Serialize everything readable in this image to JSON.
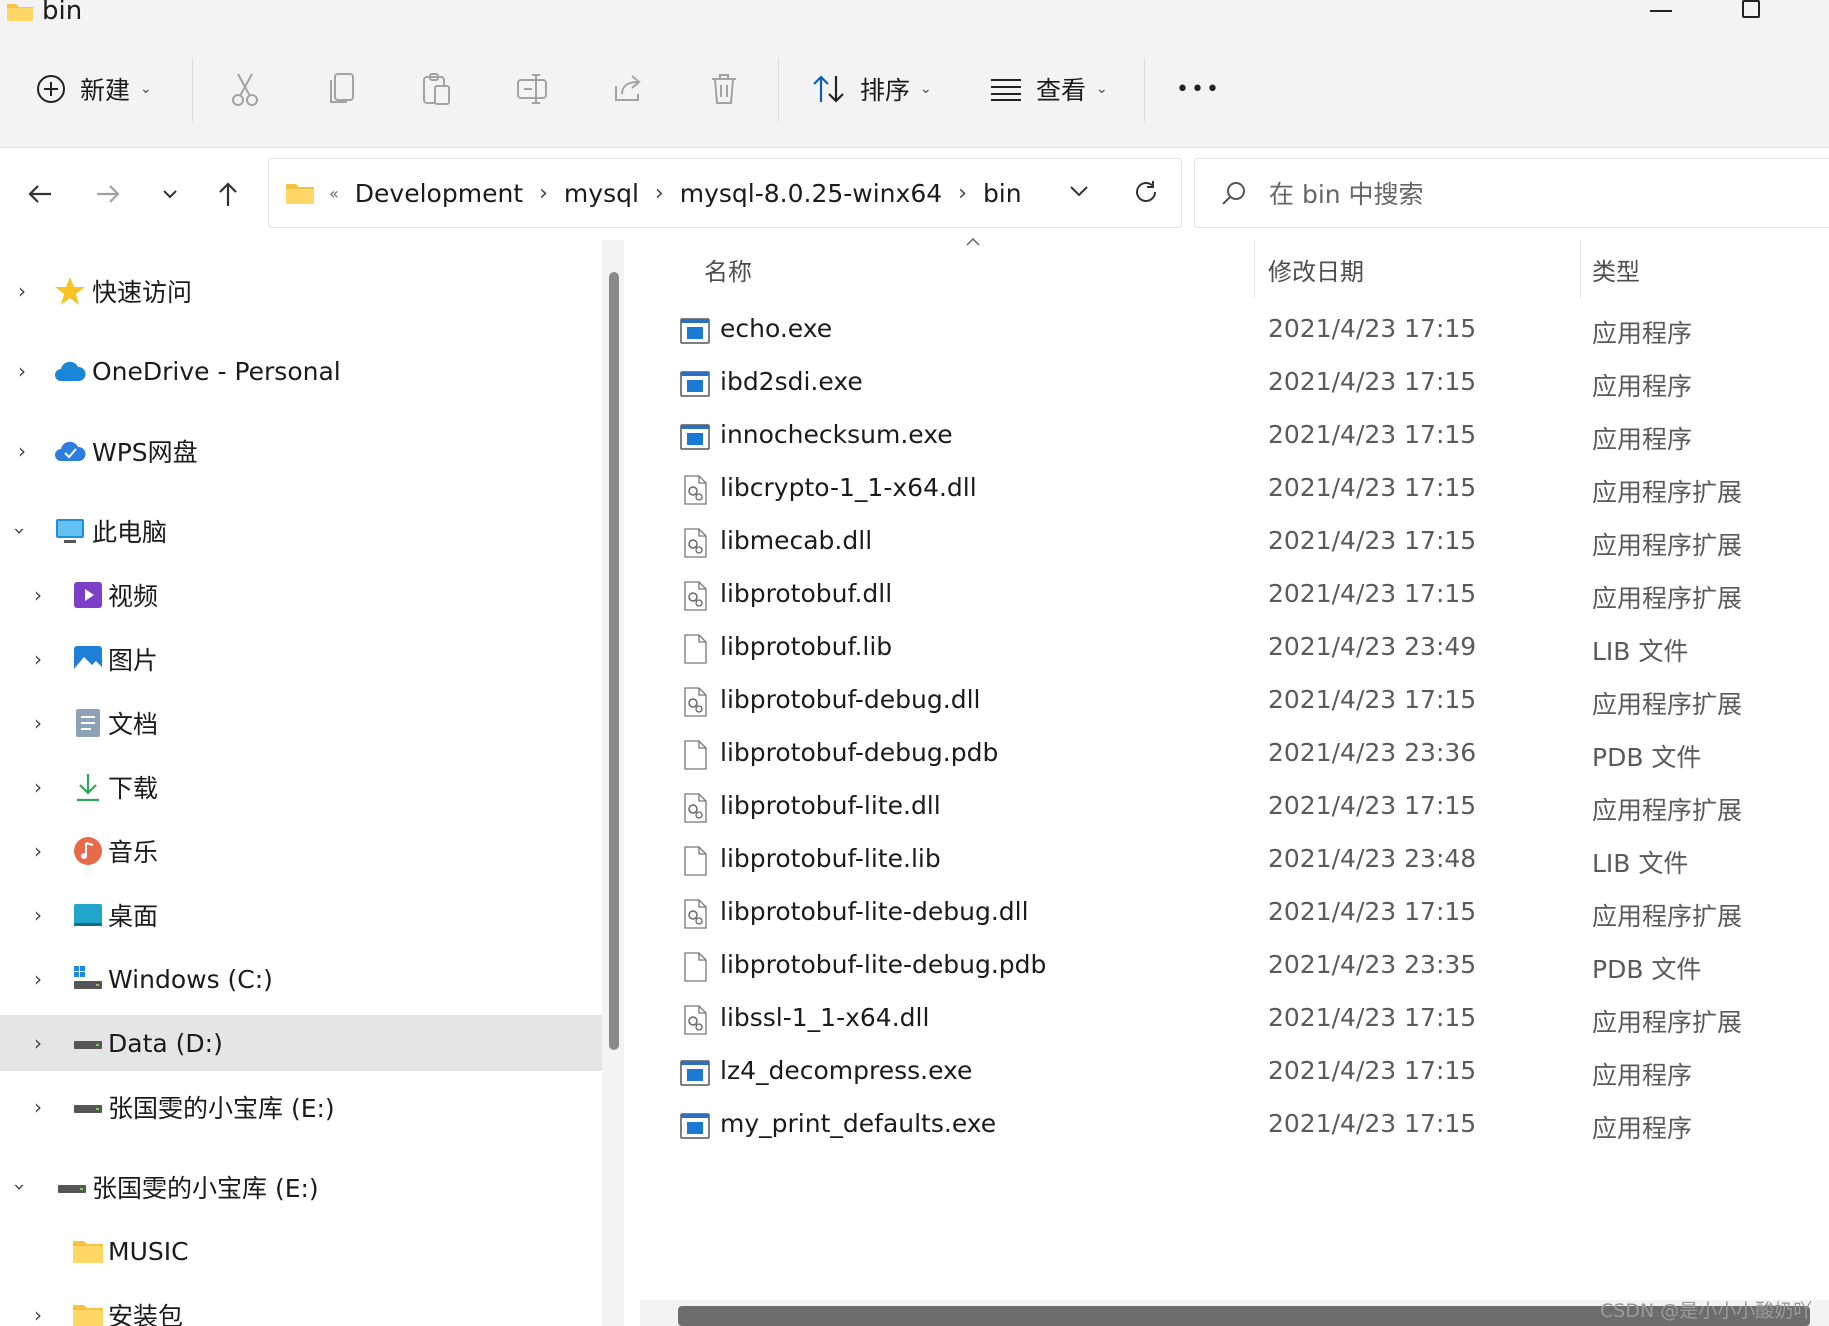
{
  "window": {
    "title": "bin"
  },
  "toolbar": {
    "new_label": "新建",
    "sort_label": "排序",
    "view_label": "查看",
    "more_label": "•••"
  },
  "address": {
    "overflow": "«",
    "crumbs": [
      "Development",
      "mysql",
      "mysql-8.0.25-winx64",
      "bin"
    ],
    "search_placeholder": "在 bin 中搜索"
  },
  "sidebar": {
    "items": [
      {
        "label": "快速访问",
        "icon": "star-icon"
      },
      {
        "label": "OneDrive - Personal",
        "icon": "cloud-icon"
      },
      {
        "label": "WPS网盘",
        "icon": "cloud-icon"
      },
      {
        "label": "此电脑",
        "icon": "monitor-icon"
      },
      {
        "label": "视频",
        "icon": "video-icon"
      },
      {
        "label": "图片",
        "icon": "picture-icon"
      },
      {
        "label": "文档",
        "icon": "document-icon"
      },
      {
        "label": "下载",
        "icon": "download-icon"
      },
      {
        "label": "音乐",
        "icon": "music-icon"
      },
      {
        "label": "桌面",
        "icon": "desktop-icon"
      },
      {
        "label": "Windows (C:)",
        "icon": "drive-icon"
      },
      {
        "label": "Data (D:)",
        "icon": "drive-icon",
        "selected": true
      },
      {
        "label": "张国雯的小宝库 (E:)",
        "icon": "drive-icon"
      },
      {
        "label": "张国雯的小宝库 (E:)",
        "icon": "drive-icon"
      },
      {
        "label": "MUSIC",
        "icon": "folder-icon"
      },
      {
        "label": "安装包",
        "icon": "folder-icon"
      }
    ]
  },
  "columns": {
    "name": "名称",
    "date": "修改日期",
    "type": "类型"
  },
  "files": [
    {
      "name": "echo.exe",
      "date": "2021/4/23 17:15",
      "type": "应用程序",
      "kind": "exe"
    },
    {
      "name": "ibd2sdi.exe",
      "date": "2021/4/23 17:15",
      "type": "应用程序",
      "kind": "exe"
    },
    {
      "name": "innochecksum.exe",
      "date": "2021/4/23 17:15",
      "type": "应用程序",
      "kind": "exe"
    },
    {
      "name": "libcrypto-1_1-x64.dll",
      "date": "2021/4/23 17:15",
      "type": "应用程序扩展",
      "kind": "dll"
    },
    {
      "name": "libmecab.dll",
      "date": "2021/4/23 17:15",
      "type": "应用程序扩展",
      "kind": "dll"
    },
    {
      "name": "libprotobuf.dll",
      "date": "2021/4/23 17:15",
      "type": "应用程序扩展",
      "kind": "dll"
    },
    {
      "name": "libprotobuf.lib",
      "date": "2021/4/23 23:49",
      "type": "LIB 文件",
      "kind": "file"
    },
    {
      "name": "libprotobuf-debug.dll",
      "date": "2021/4/23 17:15",
      "type": "应用程序扩展",
      "kind": "dll"
    },
    {
      "name": "libprotobuf-debug.pdb",
      "date": "2021/4/23 23:36",
      "type": "PDB 文件",
      "kind": "file"
    },
    {
      "name": "libprotobuf-lite.dll",
      "date": "2021/4/23 17:15",
      "type": "应用程序扩展",
      "kind": "dll"
    },
    {
      "name": "libprotobuf-lite.lib",
      "date": "2021/4/23 23:48",
      "type": "LIB 文件",
      "kind": "file"
    },
    {
      "name": "libprotobuf-lite-debug.dll",
      "date": "2021/4/23 17:15",
      "type": "应用程序扩展",
      "kind": "dll"
    },
    {
      "name": "libprotobuf-lite-debug.pdb",
      "date": "2021/4/23 23:35",
      "type": "PDB 文件",
      "kind": "file"
    },
    {
      "name": "libssl-1_1-x64.dll",
      "date": "2021/4/23 17:15",
      "type": "应用程序扩展",
      "kind": "dll"
    },
    {
      "name": "lz4_decompress.exe",
      "date": "2021/4/23 17:15",
      "type": "应用程序",
      "kind": "exe"
    },
    {
      "name": "my_print_defaults.exe",
      "date": "2021/4/23 17:15",
      "type": "应用程序",
      "kind": "exe"
    }
  ],
  "watermark": "CSDN @是小小小酸奶吖"
}
